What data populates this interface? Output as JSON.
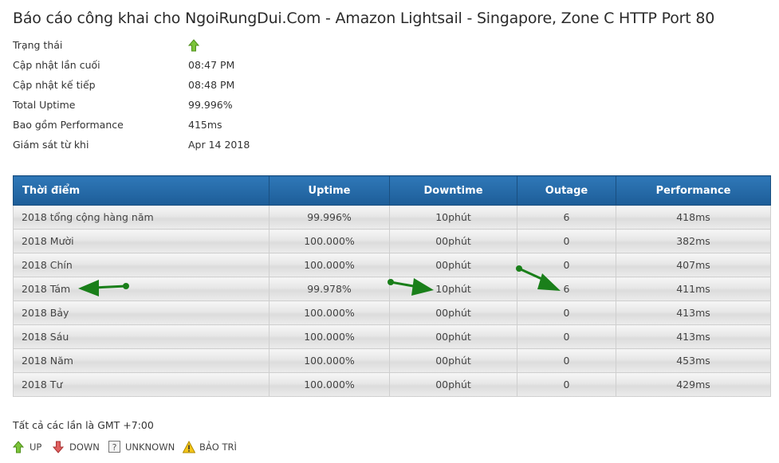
{
  "title": "Báo cáo công khai cho NgoiRungDui.Com - Amazon Lightsail - Singapore, Zone C HTTP Port 80",
  "info": {
    "status_label": "Trạng thái",
    "status_icon": "up-arrow-icon",
    "last_update_label": "Cập nhật lần cuối",
    "last_update_value": "08:47 PM",
    "next_update_label": "Cập nhật kế tiếp",
    "next_update_value": "08:48 PM",
    "total_uptime_label": "Total Uptime",
    "total_uptime_value": "99.996%",
    "performance_label": "Bao gồm Performance",
    "performance_value": "415ms",
    "monitor_since_label": "Giám sát từ khi",
    "monitor_since_value": "Apr 14 2018"
  },
  "table": {
    "headers": [
      "Thời điểm",
      "Uptime",
      "Downtime",
      "Outage",
      "Performance"
    ],
    "rows": [
      [
        "2018 tổng cộng hàng năm",
        "99.996%",
        "10phút",
        "6",
        "418ms"
      ],
      [
        "2018 Mười",
        "100.000%",
        "00phút",
        "0",
        "382ms"
      ],
      [
        "2018 Chín",
        "100.000%",
        "00phút",
        "0",
        "407ms"
      ],
      [
        "2018 Tám",
        "99.978%",
        "10phút",
        "6",
        "411ms"
      ],
      [
        "2018 Bảy",
        "100.000%",
        "00phút",
        "0",
        "413ms"
      ],
      [
        "2018 Sáu",
        "100.000%",
        "00phút",
        "0",
        "413ms"
      ],
      [
        "2018 Năm",
        "100.000%",
        "00phút",
        "0",
        "453ms"
      ],
      [
        "2018 Tư",
        "100.000%",
        "00phút",
        "0",
        "429ms"
      ]
    ],
    "header_color": "#2a6fae"
  },
  "footer": {
    "timezone_note": "Tất cả các lần là GMT +7:00"
  },
  "legend": [
    {
      "icon": "up-arrow-icon",
      "label": "UP",
      "color": "#6ab023"
    },
    {
      "icon": "down-arrow-icon",
      "label": "DOWN",
      "color": "#d9534f"
    },
    {
      "icon": "unknown-icon",
      "label": "UNKNOWN",
      "color": "#888888"
    },
    {
      "icon": "warning-icon",
      "label": "BẢO TRÌ",
      "color": "#f0b400"
    }
  ],
  "annotation_color": "#1a7f1a"
}
